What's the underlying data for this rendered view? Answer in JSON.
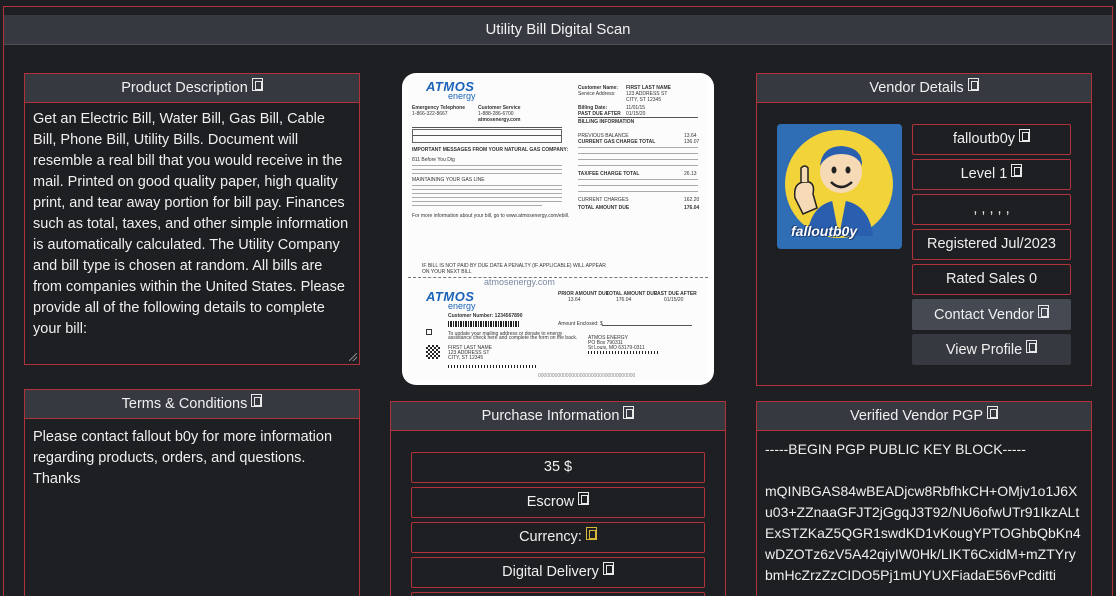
{
  "window": {
    "title": "Utility Bill Digital Scan"
  },
  "product_description": {
    "heading": "Product Description",
    "text": "Get an Electric Bill, Water Bill, Gas Bill, Cable Bill, Phone Bill, Utility Bills. Document will resemble a real bill that you would receive in the mail. Printed on good quality paper, high quality print, and tear away portion for bill pay. Finances such as total, taxes, and other simple information is automatically calculated. The Utility Company and bill type is chosen at random. All bills are from companies within the United States. Please provide all of the following details to complete your bill:"
  },
  "terms": {
    "heading": "Terms & Conditions",
    "text": "Please contact fallout b0y for more information regarding products, orders, and questions. Thanks"
  },
  "product_image": {
    "company": "ATMOS",
    "company_sub": "energy",
    "url": "atmosenergy.com",
    "customer_name": "FIRST LAST NAME",
    "address_line1": "123 ADDRESS ST",
    "address_line2": "CITY, ST 12345",
    "section_billing": "BILLING INFORMATION",
    "label_total": "TOTAL AMOUNT DUE",
    "total": "176.04",
    "customer_number": "Customer Number: 1234567890"
  },
  "purchase": {
    "heading": "Purchase Information",
    "price": "35 $",
    "escrow": "Escrow",
    "currency": "Currency:",
    "delivery": "Digital Delivery"
  },
  "vendor": {
    "heading": "Vendor Details",
    "name": "falloutb0y",
    "level": "Level 1",
    "rating": ", , , , ,",
    "registered": "Registered Jul/2023",
    "rated_sales": "Rated Sales 0",
    "contact": "Contact Vendor",
    "view_profile": "View Profile",
    "avatar_text": "falloutb0y"
  },
  "pgp": {
    "heading": "Verified Vendor PGP",
    "begin": "-----BEGIN PGP PUBLIC KEY BLOCK-----",
    "body": "mQINBGAS84wBEADjcw8RbfhkCH+OMjv1o1J6Xu03+ZZnaaGFJT2jGgqJ3T92/NU6ofwUTr91IkzALtExSTZKaZ5QGR1swdKD1vKougYPTOGhbQbKn4wDZOTz6zV5A42qiyIW0Hk/LIKT6CxidM+mZTYrybmHcZrzZzCIDO5Pj1mUYUXFiadaE56vPcditti"
  },
  "colors": {
    "accent_border": "#b0323a",
    "header_bg": "#363a40",
    "page_bg": "#1e1f22"
  }
}
